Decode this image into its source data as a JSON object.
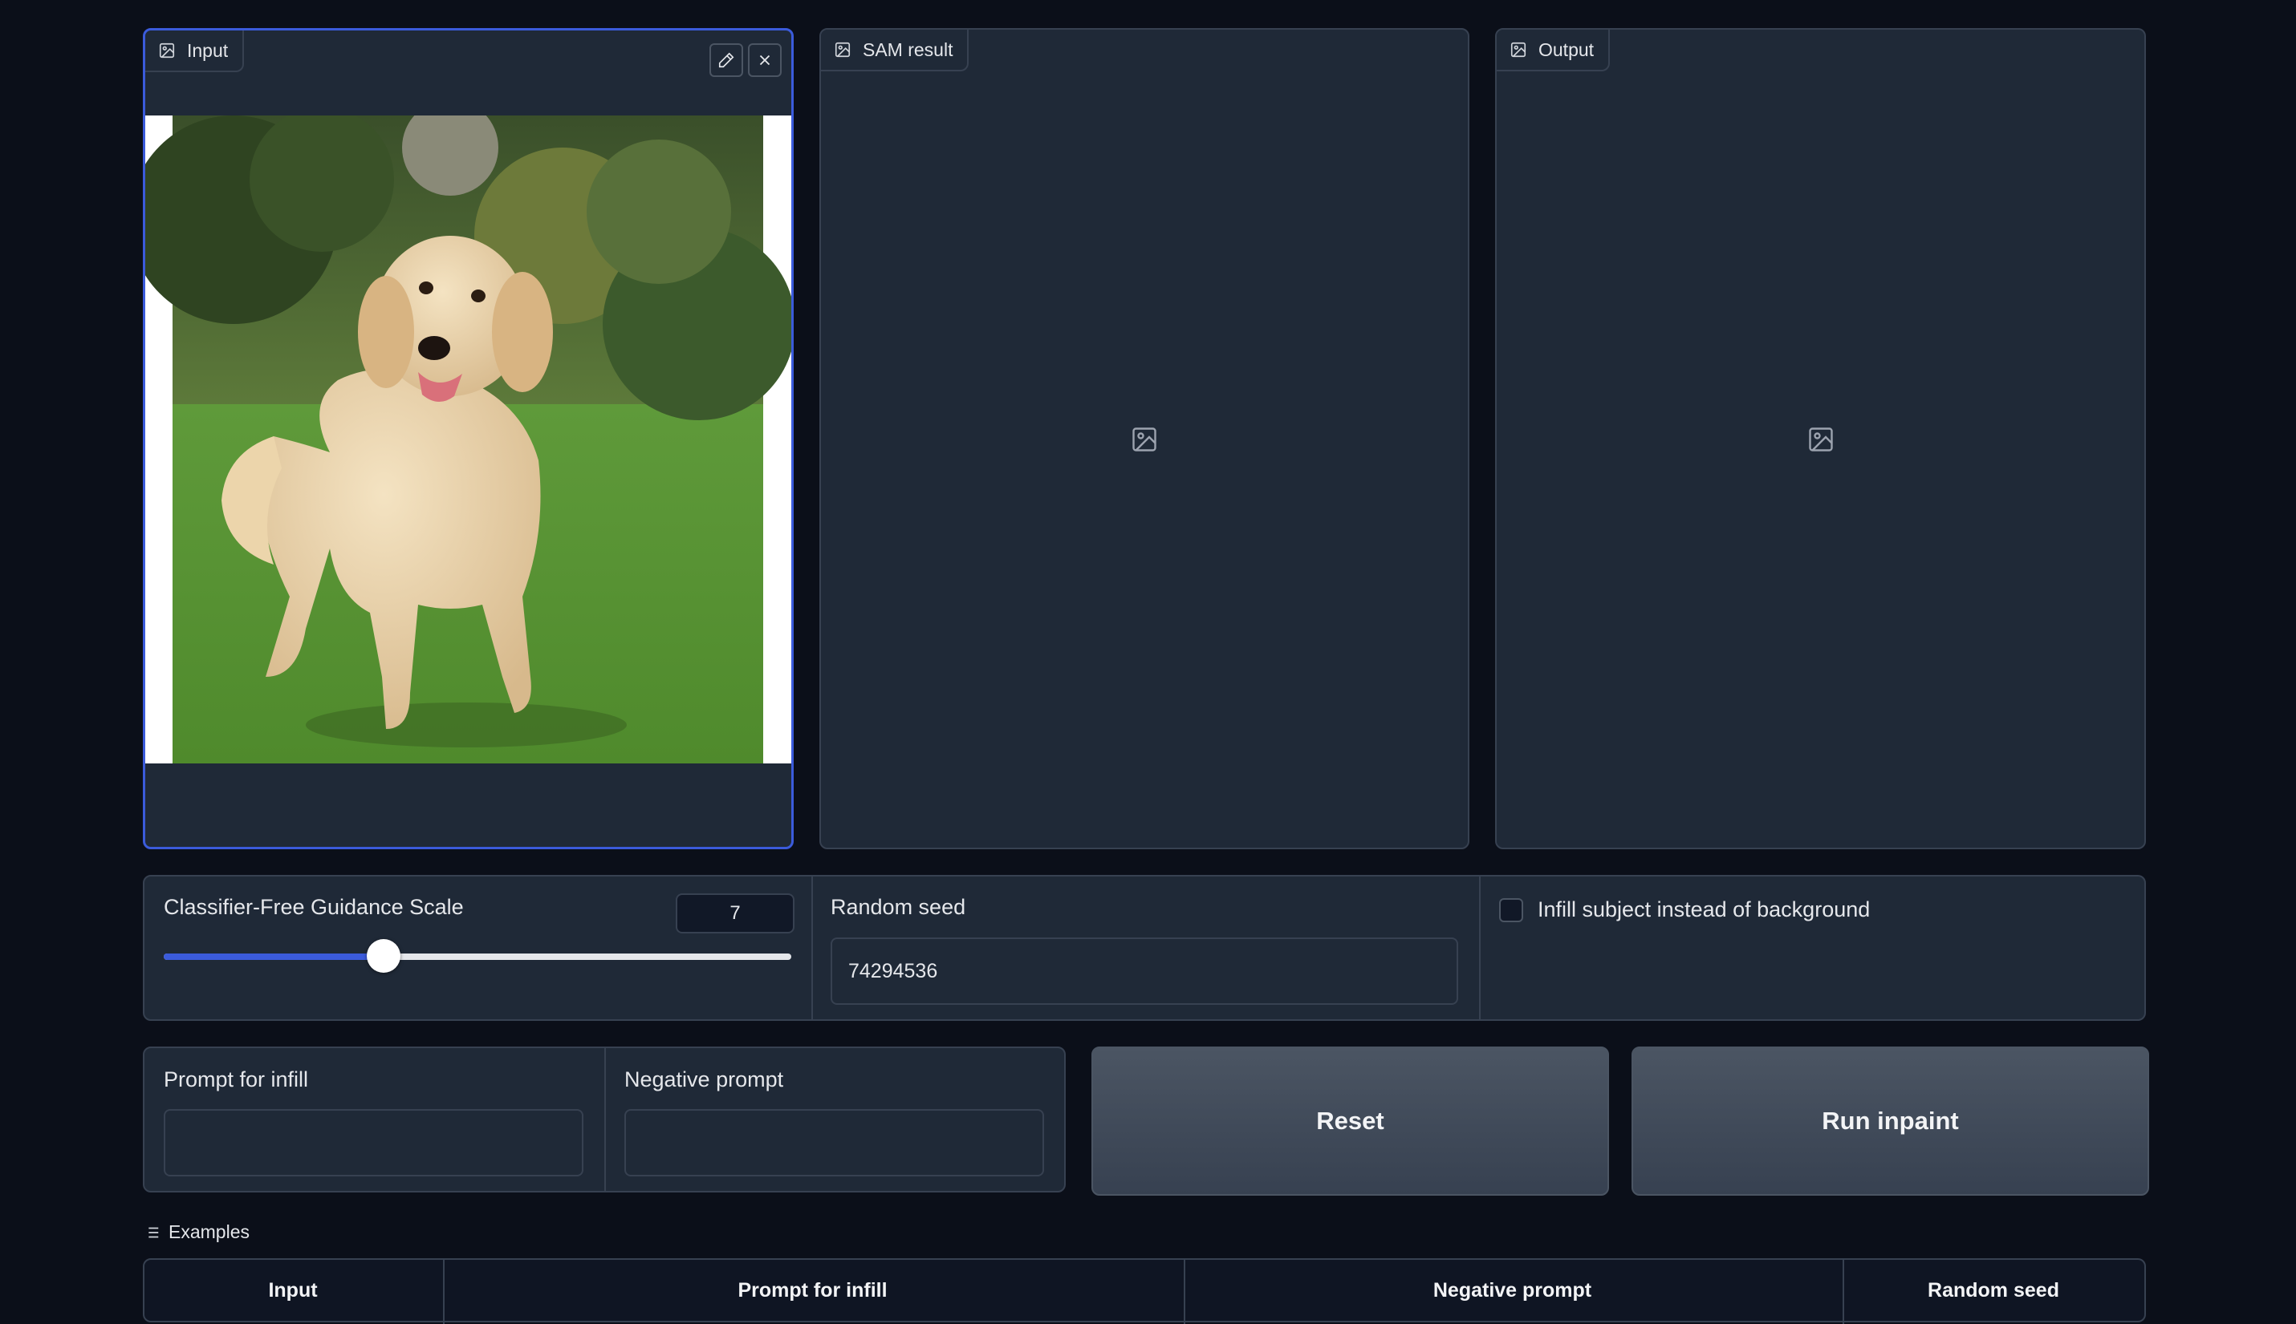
{
  "panels": {
    "input": {
      "label": "Input"
    },
    "sam_result": {
      "label": "SAM result"
    },
    "output": {
      "label": "Output"
    }
  },
  "controls": {
    "cfg_label": "Classifier-Free Guidance Scale",
    "cfg_value": "7",
    "cfg_slider": {
      "min": 0,
      "max": 20,
      "value": 7
    },
    "seed_label": "Random seed",
    "seed_value": "74294536",
    "infill_checkbox_label": "Infill subject instead of background",
    "infill_checked": false
  },
  "prompts": {
    "prompt_label": "Prompt for infill",
    "prompt_value": "",
    "negative_label": "Negative prompt",
    "negative_value": ""
  },
  "buttons": {
    "reset": "Reset",
    "run": "Run inpaint"
  },
  "examples": {
    "label": "Examples",
    "columns": [
      "Input",
      "Prompt for infill",
      "Negative prompt",
      "Random seed"
    ]
  },
  "colors": {
    "background": "#0b0f19",
    "panel": "#1f2937",
    "accent": "#3b5bdb"
  }
}
